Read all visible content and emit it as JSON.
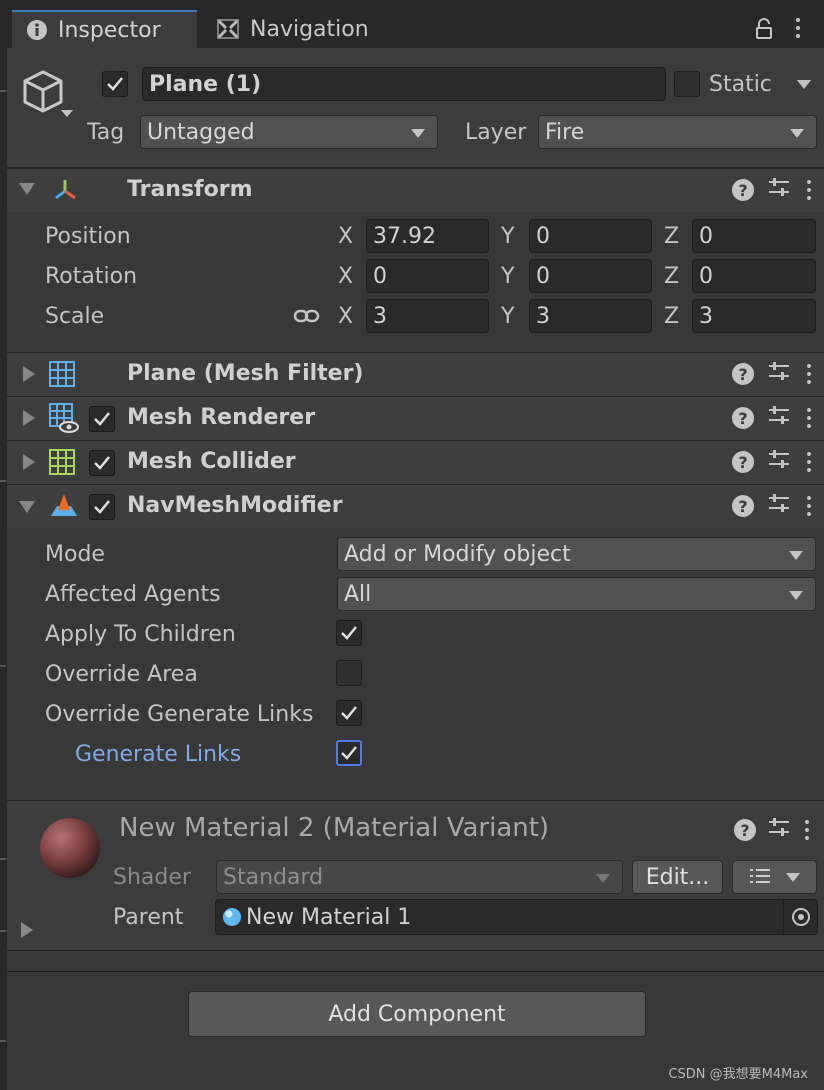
{
  "tabs": [
    {
      "label": "Inspector",
      "icon": "info-icon"
    },
    {
      "label": "Navigation",
      "icon": "navigation-icon"
    }
  ],
  "object": {
    "name": "Plane (1)",
    "active": true,
    "static_label": "Static",
    "static": false,
    "tag_label": "Tag",
    "tag_value": "Untagged",
    "layer_label": "Layer",
    "layer_value": "Fire"
  },
  "transform": {
    "title": "Transform",
    "position_label": "Position",
    "rotation_label": "Rotation",
    "scale_label": "Scale",
    "axis_x": "X",
    "axis_y": "Y",
    "axis_z": "Z",
    "position": {
      "x": "37.92",
      "y": "0",
      "z": "0"
    },
    "rotation": {
      "x": "0",
      "y": "0",
      "z": "0"
    },
    "scale": {
      "x": "3",
      "y": "3",
      "z": "3"
    }
  },
  "components": {
    "mesh_filter": "Plane (Mesh Filter)",
    "mesh_renderer": "Mesh Renderer",
    "mesh_collider": "Mesh Collider",
    "navmesh_modifier": "NavMeshModifier"
  },
  "navmesh": {
    "mode_label": "Mode",
    "mode_value": "Add or Modify object",
    "agents_label": "Affected Agents",
    "agents_value": "All",
    "apply_children_label": "Apply To Children",
    "override_area_label": "Override Area",
    "override_links_label": "Override Generate Links",
    "generate_links_label": "Generate Links"
  },
  "material": {
    "title": "New Material 2 (Material Variant)",
    "shader_label": "Shader",
    "shader_value": "Standard",
    "edit_label": "Edit...",
    "parent_label": "Parent",
    "parent_value": "New Material 1"
  },
  "add_component_label": "Add Component",
  "watermark": "CSDN @我想要M4Max",
  "colors": {
    "accent_blue": "#3a79bb",
    "link_blue": "#7fa9e8",
    "panel": "#383838",
    "header": "#3e3e3e"
  }
}
